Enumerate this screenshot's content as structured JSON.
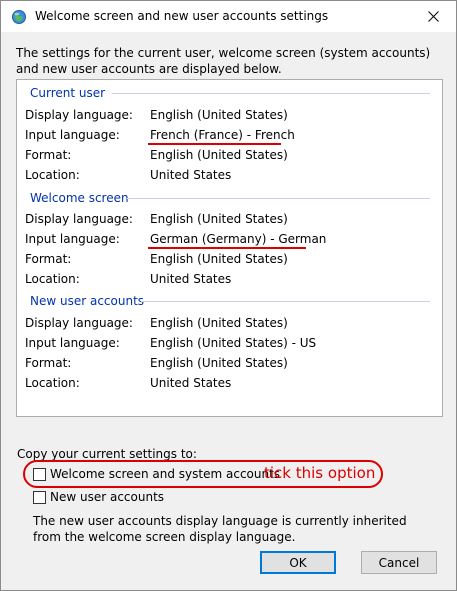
{
  "window": {
    "title": "Welcome screen and new user accounts settings"
  },
  "intro_text": "The settings for the current user, welcome screen (system accounts) and new user accounts are displayed below.",
  "sections": [
    {
      "header": "Current user",
      "rows": [
        {
          "label": "Display language:",
          "value": "English (United States)"
        },
        {
          "label": "Input language:",
          "value": "French (France) - French"
        },
        {
          "label": "Format:",
          "value": "English (United States)"
        },
        {
          "label": "Location:",
          "value": "United States"
        }
      ]
    },
    {
      "header": "Welcome screen",
      "rows": [
        {
          "label": "Display language:",
          "value": "English (United States)"
        },
        {
          "label": "Input language:",
          "value": "German (Germany) - German"
        },
        {
          "label": "Format:",
          "value": "English (United States)"
        },
        {
          "label": "Location:",
          "value": "United States"
        }
      ]
    },
    {
      "header": "New user accounts",
      "rows": [
        {
          "label": "Display language:",
          "value": "English (United States)"
        },
        {
          "label": "Input language:",
          "value": "English (United States) - US"
        },
        {
          "label": "Format:",
          "value": "English (United States)"
        },
        {
          "label": "Location:",
          "value": "United States"
        }
      ]
    }
  ],
  "copy": {
    "label": "Copy your current settings to:",
    "option_welcome": {
      "label": "Welcome screen and system accounts",
      "checked": false
    },
    "option_new_users": {
      "label": "New user accounts",
      "checked": false
    }
  },
  "annotation": "tick this option",
  "info_text": "The new user accounts display language is currently inherited from the welcome screen display language.",
  "buttons": {
    "ok": "OK",
    "cancel": "Cancel"
  },
  "colors": {
    "section_header": "#0033aa",
    "annotation_red": "#dd0000"
  }
}
